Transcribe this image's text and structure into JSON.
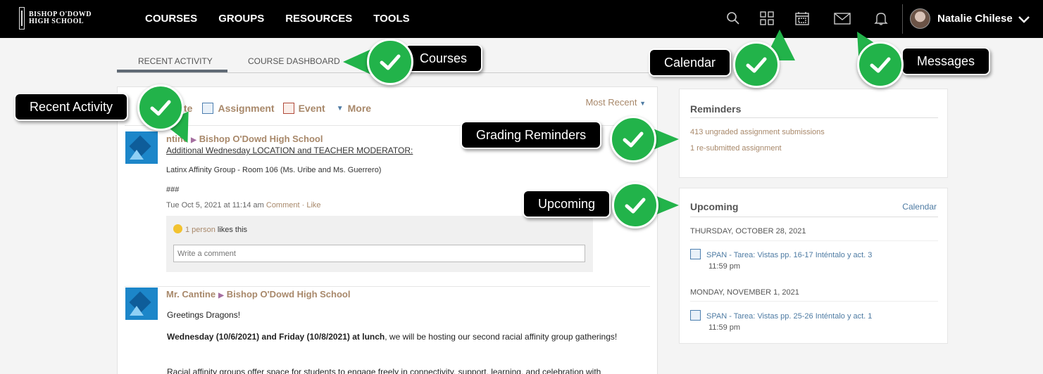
{
  "header": {
    "logo_line1": "BISHOP O'DOWD",
    "logo_line2": "HIGH SCHOOL",
    "nav": [
      "COURSES",
      "GROUPS",
      "RESOURCES",
      "TOOLS"
    ],
    "user_name": "Natalie Chilese",
    "icons": [
      "search-icon",
      "apps-grid-icon",
      "calendar-icon",
      "envelope-icon",
      "bell-icon"
    ]
  },
  "tabs": {
    "recent": "RECENT ACTIVITY",
    "course": "COURSE DASHBOARD"
  },
  "feed": {
    "post_options": [
      "te",
      "Assignment",
      "Event",
      "More"
    ],
    "sort": "Most Recent",
    "post1": {
      "author": "ntine",
      "group": "Bishop O'Dowd High School",
      "title": "Additional Wednesday LOCATION and TEACHER MODERATOR:",
      "line1": "Latinx Affinity Group - Room 106 (Ms. Uribe and Ms. Guerrero)",
      "line2": "###",
      "date": "Tue Oct 5, 2021 at 11:14 am",
      "comment_link": "Comment",
      "like_link": "Like",
      "likes_count": "1 person",
      "likes_suffix": "likes this",
      "comment_placeholder": "Write a comment"
    },
    "post2": {
      "author": "Mr. Cantine",
      "group": "Bishop O'Dowd High School",
      "greeting": "Greetings Dragons!",
      "bold": "Wednesday (10/6/2021) and Friday (10/8/2021) at lunch",
      "rest": ", we will be hosting our second racial affinity group gatherings!",
      "cut": "Racial affinity groups offer space for students to engage freely in connectivity, support, learning, and celebration with"
    }
  },
  "reminders": {
    "title": "Reminders",
    "items": [
      "413 ungraded assignment submissions",
      "1 re-submitted assignment"
    ]
  },
  "upcoming": {
    "title": "Upcoming",
    "calendar_link": "Calendar",
    "days": [
      {
        "head": "THURSDAY, OCTOBER 28, 2021",
        "event": "SPAN - Tarea: Vistas pp. 16-17 Inténtalo y act. 3",
        "time": "11:59 pm"
      },
      {
        "head": "MONDAY, NOVEMBER 1, 2021",
        "event": "SPAN - Tarea: Vistas pp. 25-26 Inténtalo y act. 1",
        "time": "11:59 pm"
      }
    ]
  },
  "callouts": {
    "courses": "Courses",
    "calendar": "Calendar",
    "messages": "Messages",
    "recent_activity": "Recent Activity",
    "grading_reminders": "Grading Reminders",
    "upcoming": "Upcoming"
  },
  "colors": {
    "accent_link": "#a8886a",
    "blue_link": "#4e7ba3",
    "check_green": "#22b34a",
    "topbar": "#000000"
  }
}
